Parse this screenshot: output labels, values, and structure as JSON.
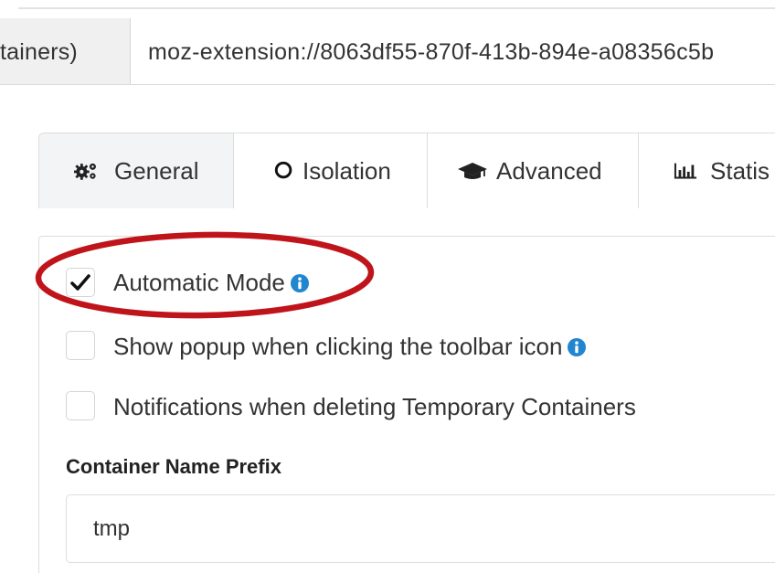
{
  "browser": {
    "tab_title_fragment": "tainers)",
    "url": "moz-extension://8063df55-870f-413b-894e-a08356c5b"
  },
  "tabs": [
    {
      "label": "General",
      "icon": "gears-icon",
      "active": true
    },
    {
      "label": "Isolation",
      "icon": "circle-icon",
      "active": false
    },
    {
      "label": "Advanced",
      "icon": "graduation-cap-icon",
      "active": false
    },
    {
      "label": "Statis",
      "icon": "bar-chart-icon",
      "active": false
    }
  ],
  "general": {
    "automatic_mode": {
      "label": "Automatic Mode",
      "checked": true,
      "info_icon": "info-icon"
    },
    "show_popup": {
      "label": "Show popup when clicking the toolbar icon",
      "checked": false,
      "info_icon": "info-icon"
    },
    "notifications": {
      "label": "Notifications when deleting Temporary Containers",
      "checked": false
    },
    "container_prefix": {
      "label": "Container Name Prefix",
      "value": "tmp"
    }
  },
  "colors": {
    "info_blue": "#2185d0",
    "highlight_red": "#c0141b"
  }
}
